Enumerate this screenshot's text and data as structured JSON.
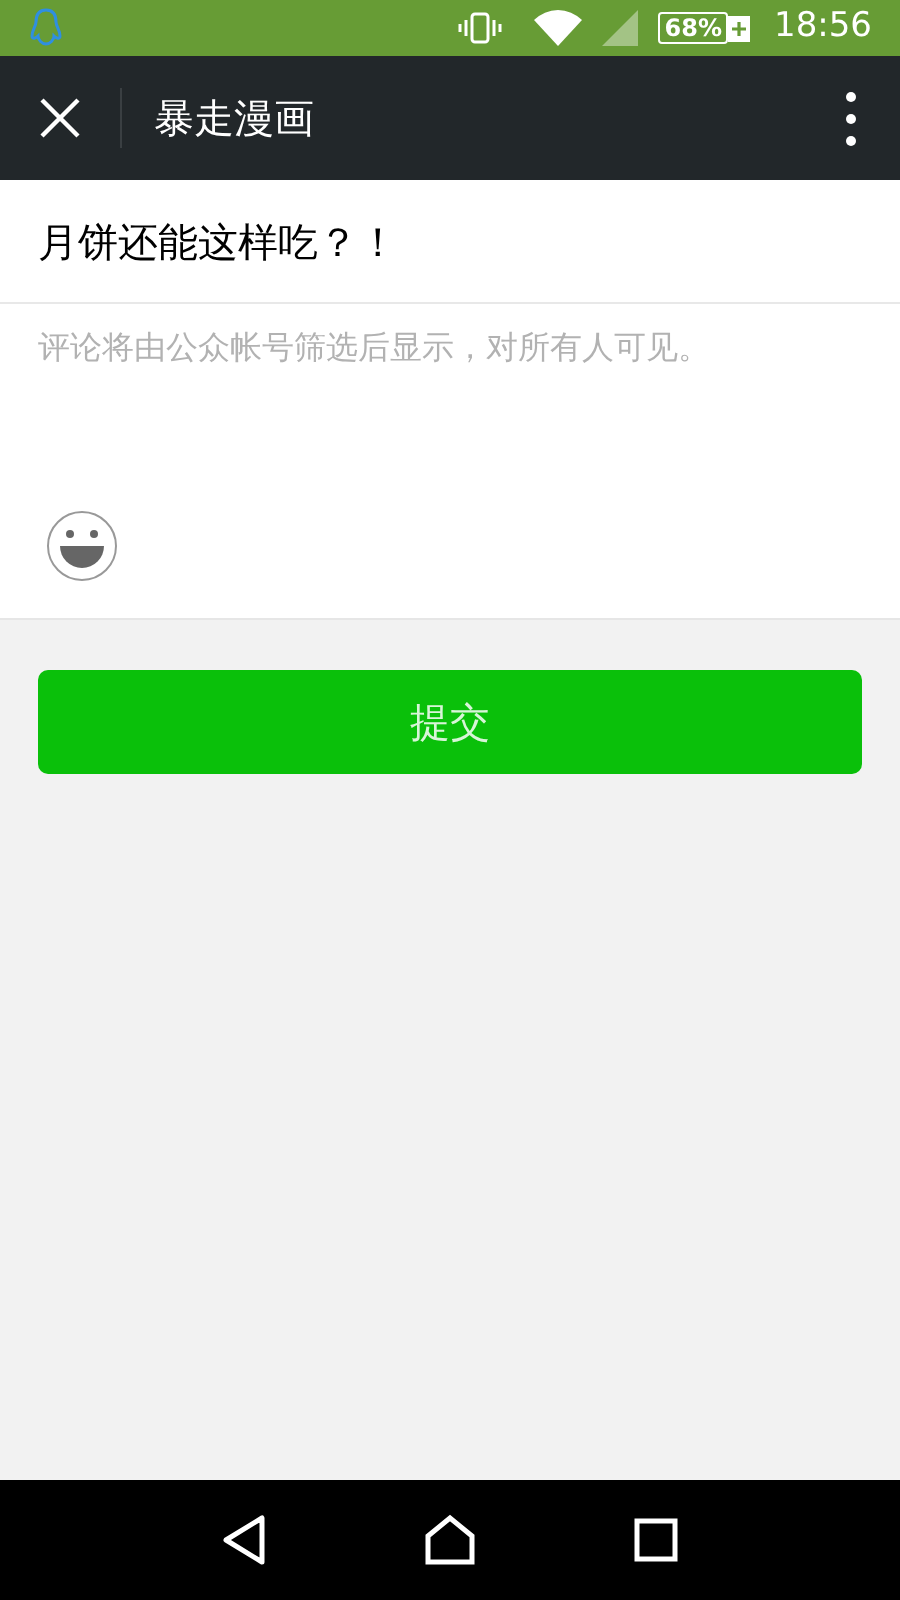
{
  "status_bar": {
    "battery": "68%",
    "time": "18:56"
  },
  "header": {
    "title": "暴走漫画"
  },
  "article_title": "月饼还能这样吃？！",
  "comment": {
    "placeholder": "评论将由公众帐号筛选后显示，对所有人可见。"
  },
  "submit_button": "提交"
}
